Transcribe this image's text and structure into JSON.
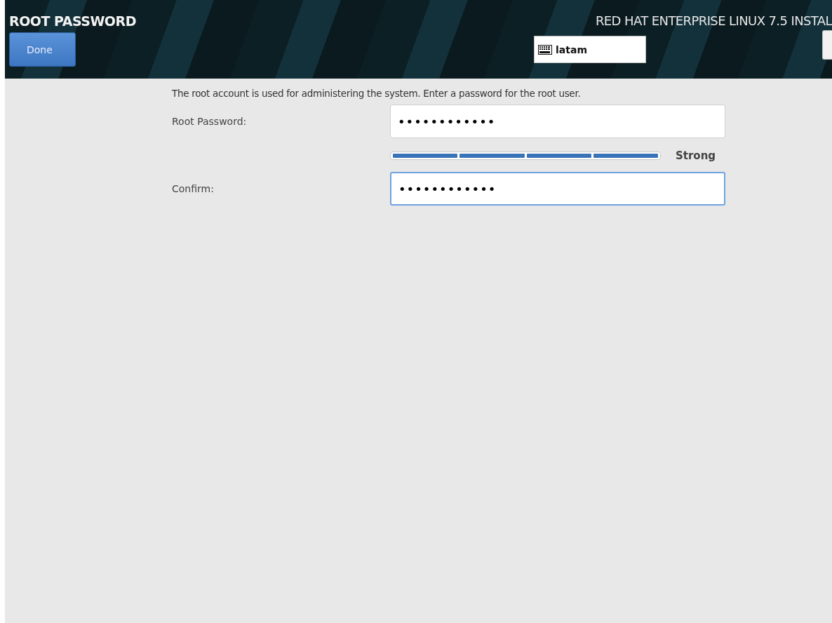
{
  "header": {
    "title": "ROOT PASSWORD",
    "done_button": "Done",
    "product": "RED HAT ENTERPRISE LINUX 7.5 INSTAL",
    "keyboard_layout": "latam"
  },
  "description": "The root account is used for administering the system.  Enter a password for the root user.",
  "fields": [
    {
      "label": "Root Password:",
      "value": "••••••••••••",
      "focused": false
    },
    {
      "label": "Confirm:",
      "value": "••••••••••••",
      "focused": true
    }
  ],
  "strength": {
    "segments": [
      {
        "filled": true
      },
      {
        "filled": true
      },
      {
        "filled": true
      },
      {
        "filled": true
      }
    ],
    "label": "Strong"
  }
}
